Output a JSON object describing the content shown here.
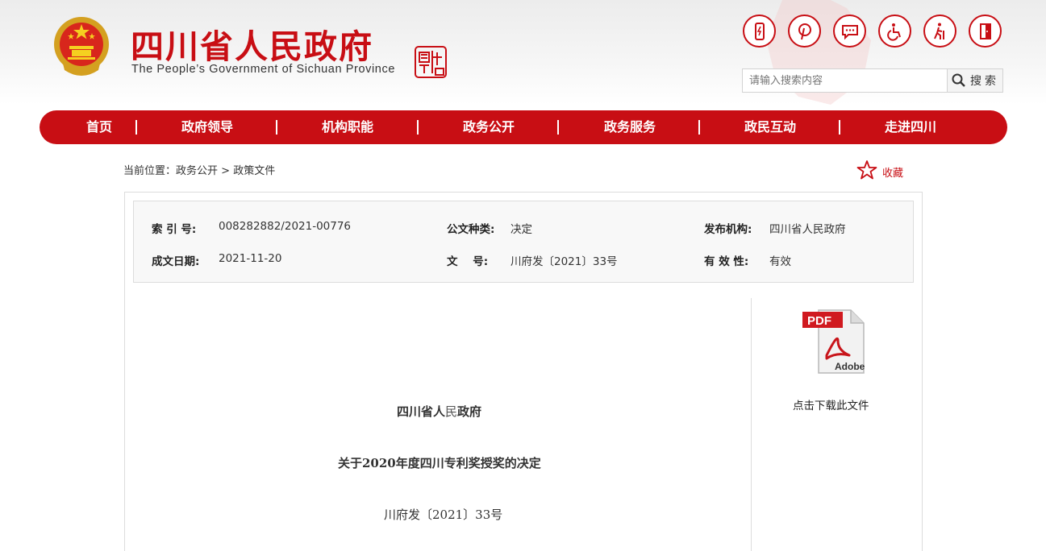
{
  "header": {
    "title": "四川省人民政府",
    "subtitle": "The People’s Government of Sichuan Province",
    "seal_text": "中國四川",
    "tools": [
      {
        "icon": "mobile-icon",
        "name": "mobile"
      },
      {
        "icon": "pinterest-icon",
        "name": "pinterest"
      },
      {
        "icon": "message-icon",
        "name": "message"
      },
      {
        "icon": "accessibility-icon",
        "name": "accessibility"
      },
      {
        "icon": "elderly-icon",
        "name": "elderly"
      },
      {
        "icon": "exit-icon",
        "name": "exit"
      }
    ],
    "search": {
      "placeholder": "请输入搜索内容",
      "button": "搜索"
    }
  },
  "nav": {
    "items": [
      "首页",
      "政府领导",
      "机构职能",
      "政务公开",
      "政务服务",
      "政民互动",
      "走进四川"
    ]
  },
  "breadcrumb": {
    "prefix": "当前位置：",
    "level1": "政务公开",
    "sep": " > ",
    "level2": "政策文件"
  },
  "favorite": {
    "label": "收藏"
  },
  "meta": {
    "index_label": "索 引 号:",
    "index_value": "008282882/2021-00776",
    "type_label": "公文种类:",
    "type_value": "决定",
    "org_label": "发布机构:",
    "org_value": "四川省人民政府",
    "date_label": "成文日期:",
    "date_value": "2021-11-20",
    "docno_label": "文    号:",
    "docno_value": "川府发〔2021〕33号",
    "validity_label": "有 效 性:",
    "validity_value": "有效"
  },
  "download": {
    "pdf_text": "PDF",
    "brand": "Adobe",
    "label": "点击下载此文件"
  },
  "document": {
    "issuer_part1": "四川省人",
    "issuer_part2": "民",
    "issuer_part3": "政府",
    "title": "关于2020年度四川专利奖授奖的决定",
    "number": "川府发〔2021〕33号"
  },
  "colors": {
    "brand_red": "#c80e14"
  }
}
